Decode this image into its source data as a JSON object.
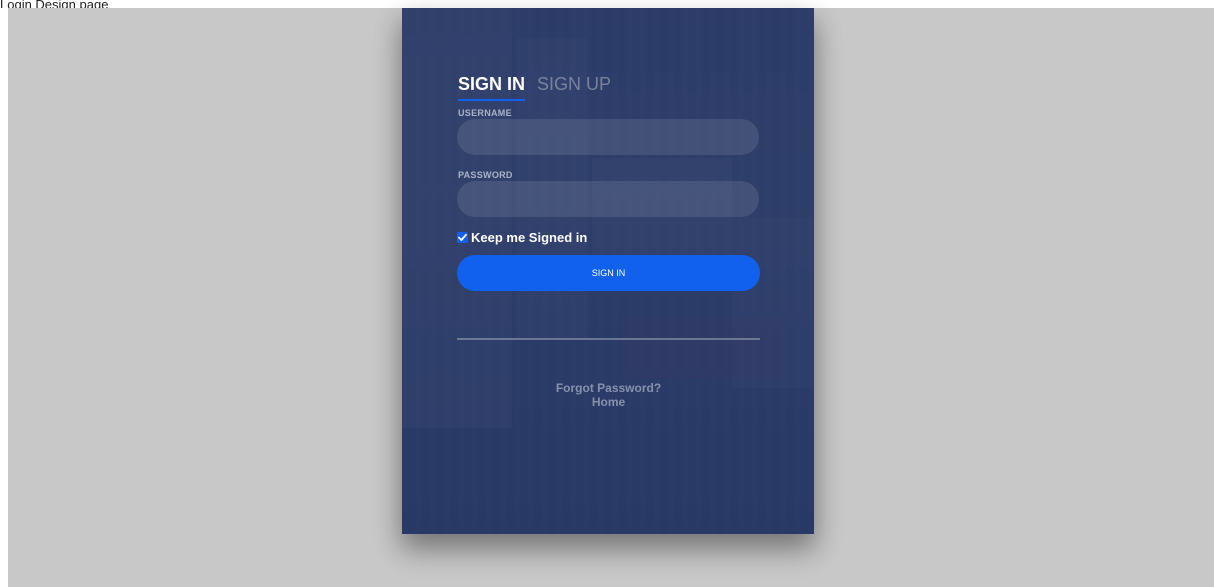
{
  "page": {
    "title": "Login Design page"
  },
  "login": {
    "tabs": [
      {
        "label": "SIGN IN",
        "active": true
      },
      {
        "label": "SIGN UP",
        "active": false
      }
    ],
    "username_label": "USERNAME",
    "username_value": "",
    "password_label": "PASSWORD",
    "password_value": "",
    "keep_signed_in_label": "Keep me Signed in",
    "keep_signed_in_checked": true,
    "submit_label": "SIGN IN",
    "forgot_password_label": "Forgot Password?",
    "home_label": "Home"
  },
  "colors": {
    "page_background": "#c8c8c8",
    "card_overlay": "#283965",
    "accent": "#1161ee",
    "text": "#ffffff"
  },
  "icons": {
    "checkbox_check": "check-icon"
  }
}
